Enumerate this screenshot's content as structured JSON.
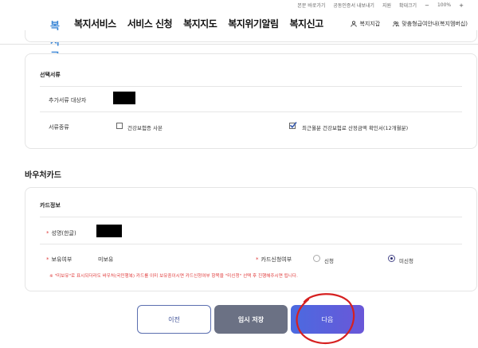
{
  "util_bar": {
    "links": [
      "본문 바로가기",
      "공동인증서 내보내기",
      "지원",
      "확대크기"
    ],
    "zoom_minus": "−",
    "zoom_value": "100%",
    "zoom_plus": "+"
  },
  "header": {
    "logo_text": "복지로",
    "nav": [
      "복지서비스",
      "서비스 신청",
      "복지지도",
      "복지위기알림",
      "복지신고"
    ],
    "wallet_label": "복지지갑",
    "help_label": "맞춤형급여안내(복지멤버십)"
  },
  "documents": {
    "title": "선택서류",
    "target_label": "추가서류 대상자",
    "type_label": "서류종류",
    "options": [
      {
        "label": "건강보험증 사본",
        "checked": false
      },
      {
        "label": "최근월분 건강보험료 산정금액 확인서(12개월분)",
        "checked": true
      }
    ]
  },
  "voucher": {
    "section_title": "바우처카드",
    "card_title": "카드정보",
    "name_label": "성명(한글)",
    "owned_label": "보유여부",
    "owned_value": "미보유",
    "apply_label": "카드신청여부",
    "radio_options": [
      {
        "label": "신청",
        "selected": false
      },
      {
        "label": "미신청",
        "selected": true
      }
    ],
    "notice": "※ \"미보유\"로 표시되더라도 바우처(국민행복) 카드를 이미 보유중이시면 카드신청여부 항목을 \"미신청\" 선택 후 진행해주시면 됩니다."
  },
  "buttons": {
    "prev": "이전",
    "save": "임시 저장",
    "next": "다음"
  },
  "colors": {
    "accent": "#4b6ae0",
    "warning": "#e03c3c",
    "annotation_circle": "#d62020"
  }
}
